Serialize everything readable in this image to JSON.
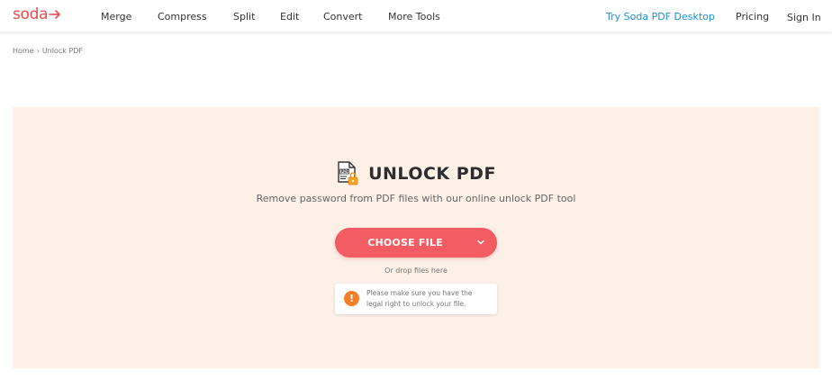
{
  "header": {
    "logo_text": "soda",
    "nav": [
      "Merge",
      "Compress",
      "Split",
      "Edit",
      "Convert",
      "More Tools"
    ],
    "desktop_link": "Try Soda PDF Desktop",
    "pricing": "Pricing",
    "sign_in": "Sign In"
  },
  "breadcrumb": {
    "home": "Home",
    "separator": "›",
    "current": "Unlock PDF"
  },
  "hero": {
    "title": "UNLOCK PDF",
    "subtitle": "Remove password from PDF files with our online unlock PDF tool",
    "choose_button": "CHOOSE FILE",
    "drop_text": "Or drop files here",
    "notice_line1": "Please make sure you have the",
    "notice_line2": "legal right to unlock your file.",
    "warn_glyph": "!"
  },
  "colors": {
    "brand": "#ef4a4a",
    "button": "#f25c62",
    "panel_bg": "#fdf0e7",
    "link_blue": "#1a8fd6",
    "warning": "#f57f28"
  },
  "icons": [
    "arrow-right-icon",
    "pdf-lock-icon",
    "chevron-down-icon",
    "warning-icon"
  ]
}
